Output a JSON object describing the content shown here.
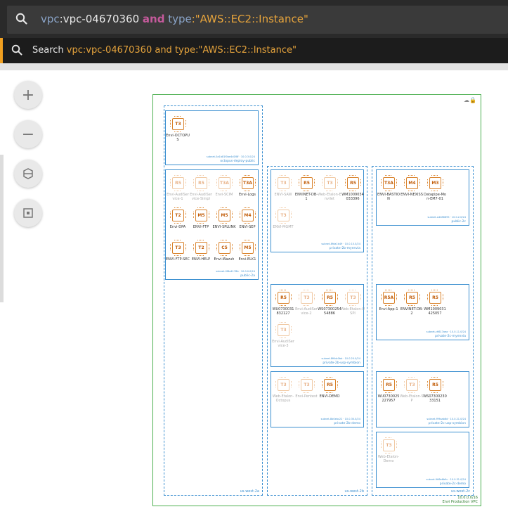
{
  "search": {
    "query_parts": [
      {
        "text": "vpc",
        "kind": "key"
      },
      {
        "text": ":vpc-04670360 ",
        "kind": "val"
      },
      {
        "text": "and",
        "kind": "op"
      },
      {
        "text": " type",
        "kind": "key"
      },
      {
        "text": ":\"AWS::EC2::Instance\"",
        "kind": "str"
      }
    ],
    "suggestion_prefix": "Search ",
    "suggestion_query": "vpc:vpc-04670360 and type:\"AWS::EC2::Instance\""
  },
  "controls": {
    "zoom_in": "+",
    "zoom_out": "−"
  },
  "vpc": {
    "name": "Envi Production VPC",
    "id": "10.0.0.0/16"
  },
  "azs": [
    {
      "label": "us-west-2a"
    },
    {
      "label": "us-west-2b"
    },
    {
      "label": "us-west-2c"
    }
  ],
  "subnets": [
    {
      "name": "octopus-deploy-public",
      "id": "subnet-0a1b81f0ae4d1f8f · 10.0.3.0/24",
      "instances": [
        {
          "type": "T3",
          "name": "Envi-OCTOPUS",
          "dim": false
        }
      ]
    },
    {
      "name": "public-2a",
      "id": "subnet-0f6a4178b · 10.0.0.0/24",
      "instances": [
        {
          "type": "R5",
          "name": "Envi-AudiService-1",
          "dim": true
        },
        {
          "type": "R5",
          "name": "Envi-AudiService-Simpl",
          "dim": true
        },
        {
          "type": "T3A",
          "name": "Envi-SCIM",
          "dim": true
        },
        {
          "type": "T3A",
          "name": "Envi-Logs",
          "dim": false
        },
        {
          "type": "T2",
          "name": "Envi-DPA",
          "dim": false
        },
        {
          "type": "M5",
          "name": "ENVI-FTP",
          "dim": false
        },
        {
          "type": "M5",
          "name": "ENVI-SPLUNK",
          "dim": false
        },
        {
          "type": "M4",
          "name": "ENVI-SEP",
          "dim": false
        },
        {
          "type": "T3",
          "name": "ENVI-FTP-SEC",
          "dim": false
        },
        {
          "type": "T2",
          "name": "ENVI-HELP",
          "dim": false
        },
        {
          "type": "C5",
          "name": "Envi-Wazuh",
          "dim": false
        },
        {
          "type": "M5",
          "name": "Envi-ELK1",
          "dim": false
        }
      ]
    },
    {
      "name": "private-2b-myenvia",
      "id": "subnet-8fda1b49 · 10.0.10.0/24",
      "instances": [
        {
          "type": "T3",
          "name": "ENVI-SAW",
          "dim": true
        },
        {
          "type": "R5",
          "name": "ENVINET-DB-1",
          "dim": false
        },
        {
          "type": "T3",
          "name": "Web-Etalon-Envilet",
          "dim": true
        },
        {
          "type": "R5",
          "name": "WM1009034033396",
          "dim": false
        },
        {
          "type": "T3",
          "name": "ENVI-MGMT",
          "dim": true
        }
      ]
    },
    {
      "name": "public-2c",
      "id": "subnet-a4286695 · 10.0.2.0/24",
      "instances": [
        {
          "type": "T3A",
          "name": "ENVI-BASTION",
          "dim": false
        },
        {
          "type": "M4",
          "name": "ENVI-NEXISS",
          "dim": false
        },
        {
          "type": "M3",
          "name": "Datapipe-Mon-EM7-01",
          "dim": false
        }
      ]
    },
    {
      "name": "private-2b-usp-symbion",
      "id": "subnet-8f6dc0bb · 10.0.20.0/24",
      "instances": [
        {
          "type": "R5",
          "name": "WU0730031832127",
          "dim": false
        },
        {
          "type": "T3",
          "name": "Envi-AudiService-2",
          "dim": true
        },
        {
          "type": "R5",
          "name": "WS0730025454886",
          "dim": false
        },
        {
          "type": "T3",
          "name": "Web-Etalon-USPI",
          "dim": true
        },
        {
          "type": "T3",
          "name": "Envi-AudiService-3",
          "dim": true
        }
      ]
    },
    {
      "name": "private-2c-myenvia",
      "id": "subnet-c6617aea · 10.0.11.0/24",
      "instances": [
        {
          "type": "R5A",
          "name": "Envi-App-1",
          "dim": false
        },
        {
          "type": "R5",
          "name": "ENVINET-DB-2",
          "dim": false
        },
        {
          "type": "R5",
          "name": "WM1009031425057",
          "dim": false
        }
      ]
    },
    {
      "name": "private-2b-demo",
      "id": "subnet-8b0ebc22 · 10.0.30.0/24",
      "instances": [
        {
          "type": "T3",
          "name": "Web-Etalon-Octopus",
          "dim": true
        },
        {
          "type": "T3",
          "name": "Envi-Pentest",
          "dim": true
        },
        {
          "type": "R5",
          "name": "ENVI-DEMO",
          "dim": false
        }
      ]
    },
    {
      "name": "private-2c-usp-symbion",
      "id": "subnet-f99aab6d · 10.0.21.0/24",
      "instances": [
        {
          "type": "R5",
          "name": "WU0730025227957",
          "dim": false
        },
        {
          "type": "T3",
          "name": "Web-Etalon-SP",
          "dim": true
        },
        {
          "type": "R5",
          "name": "WS0730023033151",
          "dim": false
        }
      ]
    },
    {
      "name": "private-2c-demo",
      "id": "subnet-966e6b9c · 10.0.31.0/24",
      "instances": [
        {
          "type": "T3",
          "name": "Web-Etalon-Demo",
          "dim": true
        }
      ]
    }
  ]
}
